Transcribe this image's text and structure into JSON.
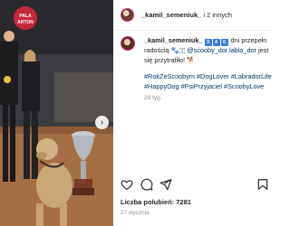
{
  "photo": {
    "sign_text": "PALA\nARTON"
  },
  "header": {
    "username": "_kamil_semeniuk_",
    "suffix": " i 2 innych"
  },
  "caption": {
    "username": "_kamil_semeniuk_",
    "digits": [
      "3",
      "4",
      "6"
    ],
    "line1_text": " dni przepełn",
    "line2_prefix": "radością ",
    "mention": "@scooby_dor.labla_dor",
    "line2_suffix": " jest",
    "line3": "się przytrafiło! ",
    "hashtags_line1": "#RokZeScoobym #DogLover #LabradorLife",
    "hashtags_line2": "#HappyDog #PsiPrzyjaciel #ScoobyLove",
    "time_ago": "29 tyg."
  },
  "stats": {
    "likes": "Liczba polubień: 7281",
    "date": "27 stycznia"
  },
  "colors": {
    "link": "#00376b",
    "muted": "#8e8e8e",
    "text": "#262626"
  }
}
